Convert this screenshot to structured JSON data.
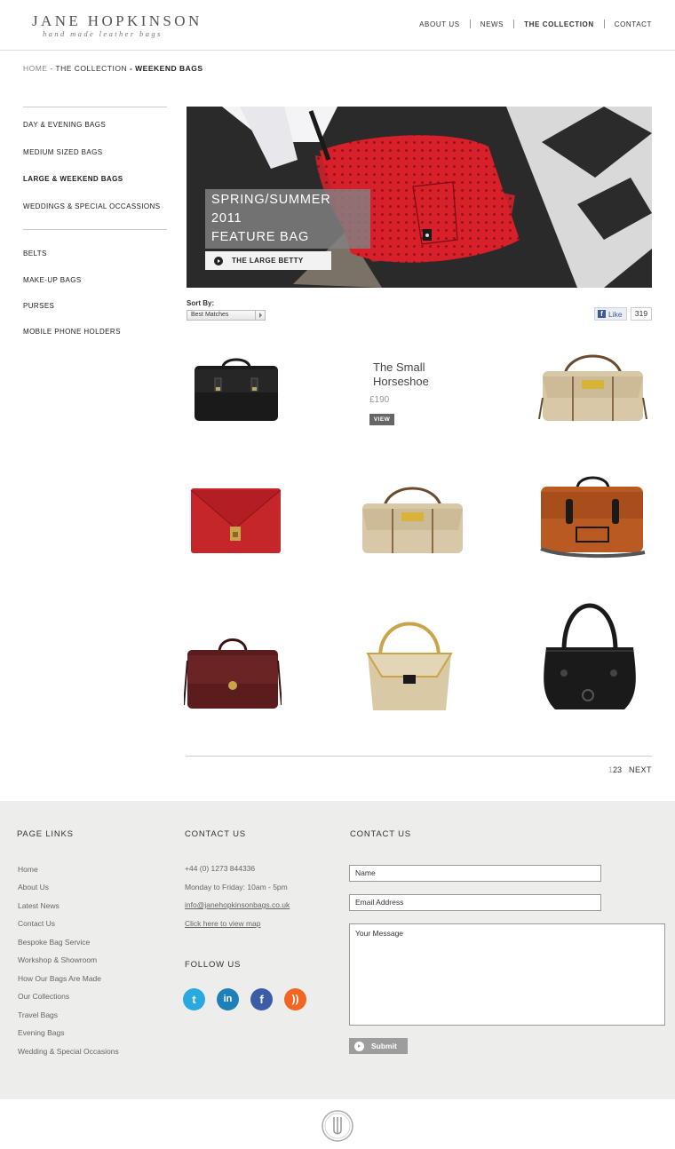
{
  "header": {
    "brand": "JANE HOPKINSON",
    "tagline": "hand made leather bags",
    "nav": [
      "ABOUT US",
      "NEWS",
      "THE COLLECTION",
      "CONTACT"
    ]
  },
  "breadcrumb": {
    "home": "HOME",
    "sep1": " - ",
    "collection": "THE COLLECTION",
    "sep2": " - ",
    "current": "WEEKEND BAGS"
  },
  "sidebar": {
    "items": [
      "DAY & EVENING BAGS",
      "MEDIUM SIZED BAGS",
      "LARGE & WEEKEND BAGS",
      "WEDDINGS & SPECIAL OCCASSIONS",
      "BELTS",
      "MAKE-UP BAGS",
      "PURSES",
      "MOBILE PHONE HOLDERS"
    ]
  },
  "feature": {
    "title_line1": "SPRING/SUMMER 2011",
    "title_line2": "FEATURE BAG",
    "button": "THE LARGE BETTY"
  },
  "sort": {
    "label": "Sort By:",
    "selected": "Best Matches"
  },
  "like": {
    "label": "Like",
    "count": "319"
  },
  "product_hover": {
    "name_line1": "The Small",
    "name_line2": "Horseshoe",
    "price": "£190",
    "view": "VIEW"
  },
  "pagination": {
    "current": "1",
    "pages": [
      "2",
      "3"
    ],
    "next": "NEXT"
  },
  "footer": {
    "col1": {
      "heading": "PAGE LINKS",
      "links": [
        "Home",
        "About Us",
        "Latest News",
        "Contact Us",
        "Bespoke Bag Service",
        "Workshop & Showroom",
        "How Our Bags Are Made",
        "Our Collections",
        "Travel Bags",
        "Evening Bags",
        "Wedding & Special Occasions"
      ]
    },
    "col2": {
      "heading": "CONTACT US",
      "phone": "+44 (0) 1273 844336",
      "hours": "Monday to Friday: 10am - 5pm",
      "email": "info@janehopkinsonbags.co.uk",
      "map": "Click here to view map",
      "follow_heading": "FOLLOW US"
    },
    "col3": {
      "heading": "CONTACT US",
      "name_value": "Name",
      "email_value": "Email Address",
      "message_value": "Your Message",
      "submit": "Submit"
    }
  },
  "colors": {
    "bag_red": "#d8202a",
    "bag_black": "#1a1a1a",
    "bag_tan": "#b85a22",
    "bag_cream": "#d8c8a8",
    "bag_burgundy": "#5a1c1c",
    "footer_bg": "#ededeb",
    "twitter": "#2aa9e0",
    "linkedin": "#1f7fb6",
    "facebook": "#3b5da8",
    "rss": "#f26522"
  },
  "icons": [
    "play-circle-icon",
    "facebook-icon",
    "twitter-icon",
    "linkedin-icon",
    "rss-icon",
    "logo-monogram-icon"
  ]
}
